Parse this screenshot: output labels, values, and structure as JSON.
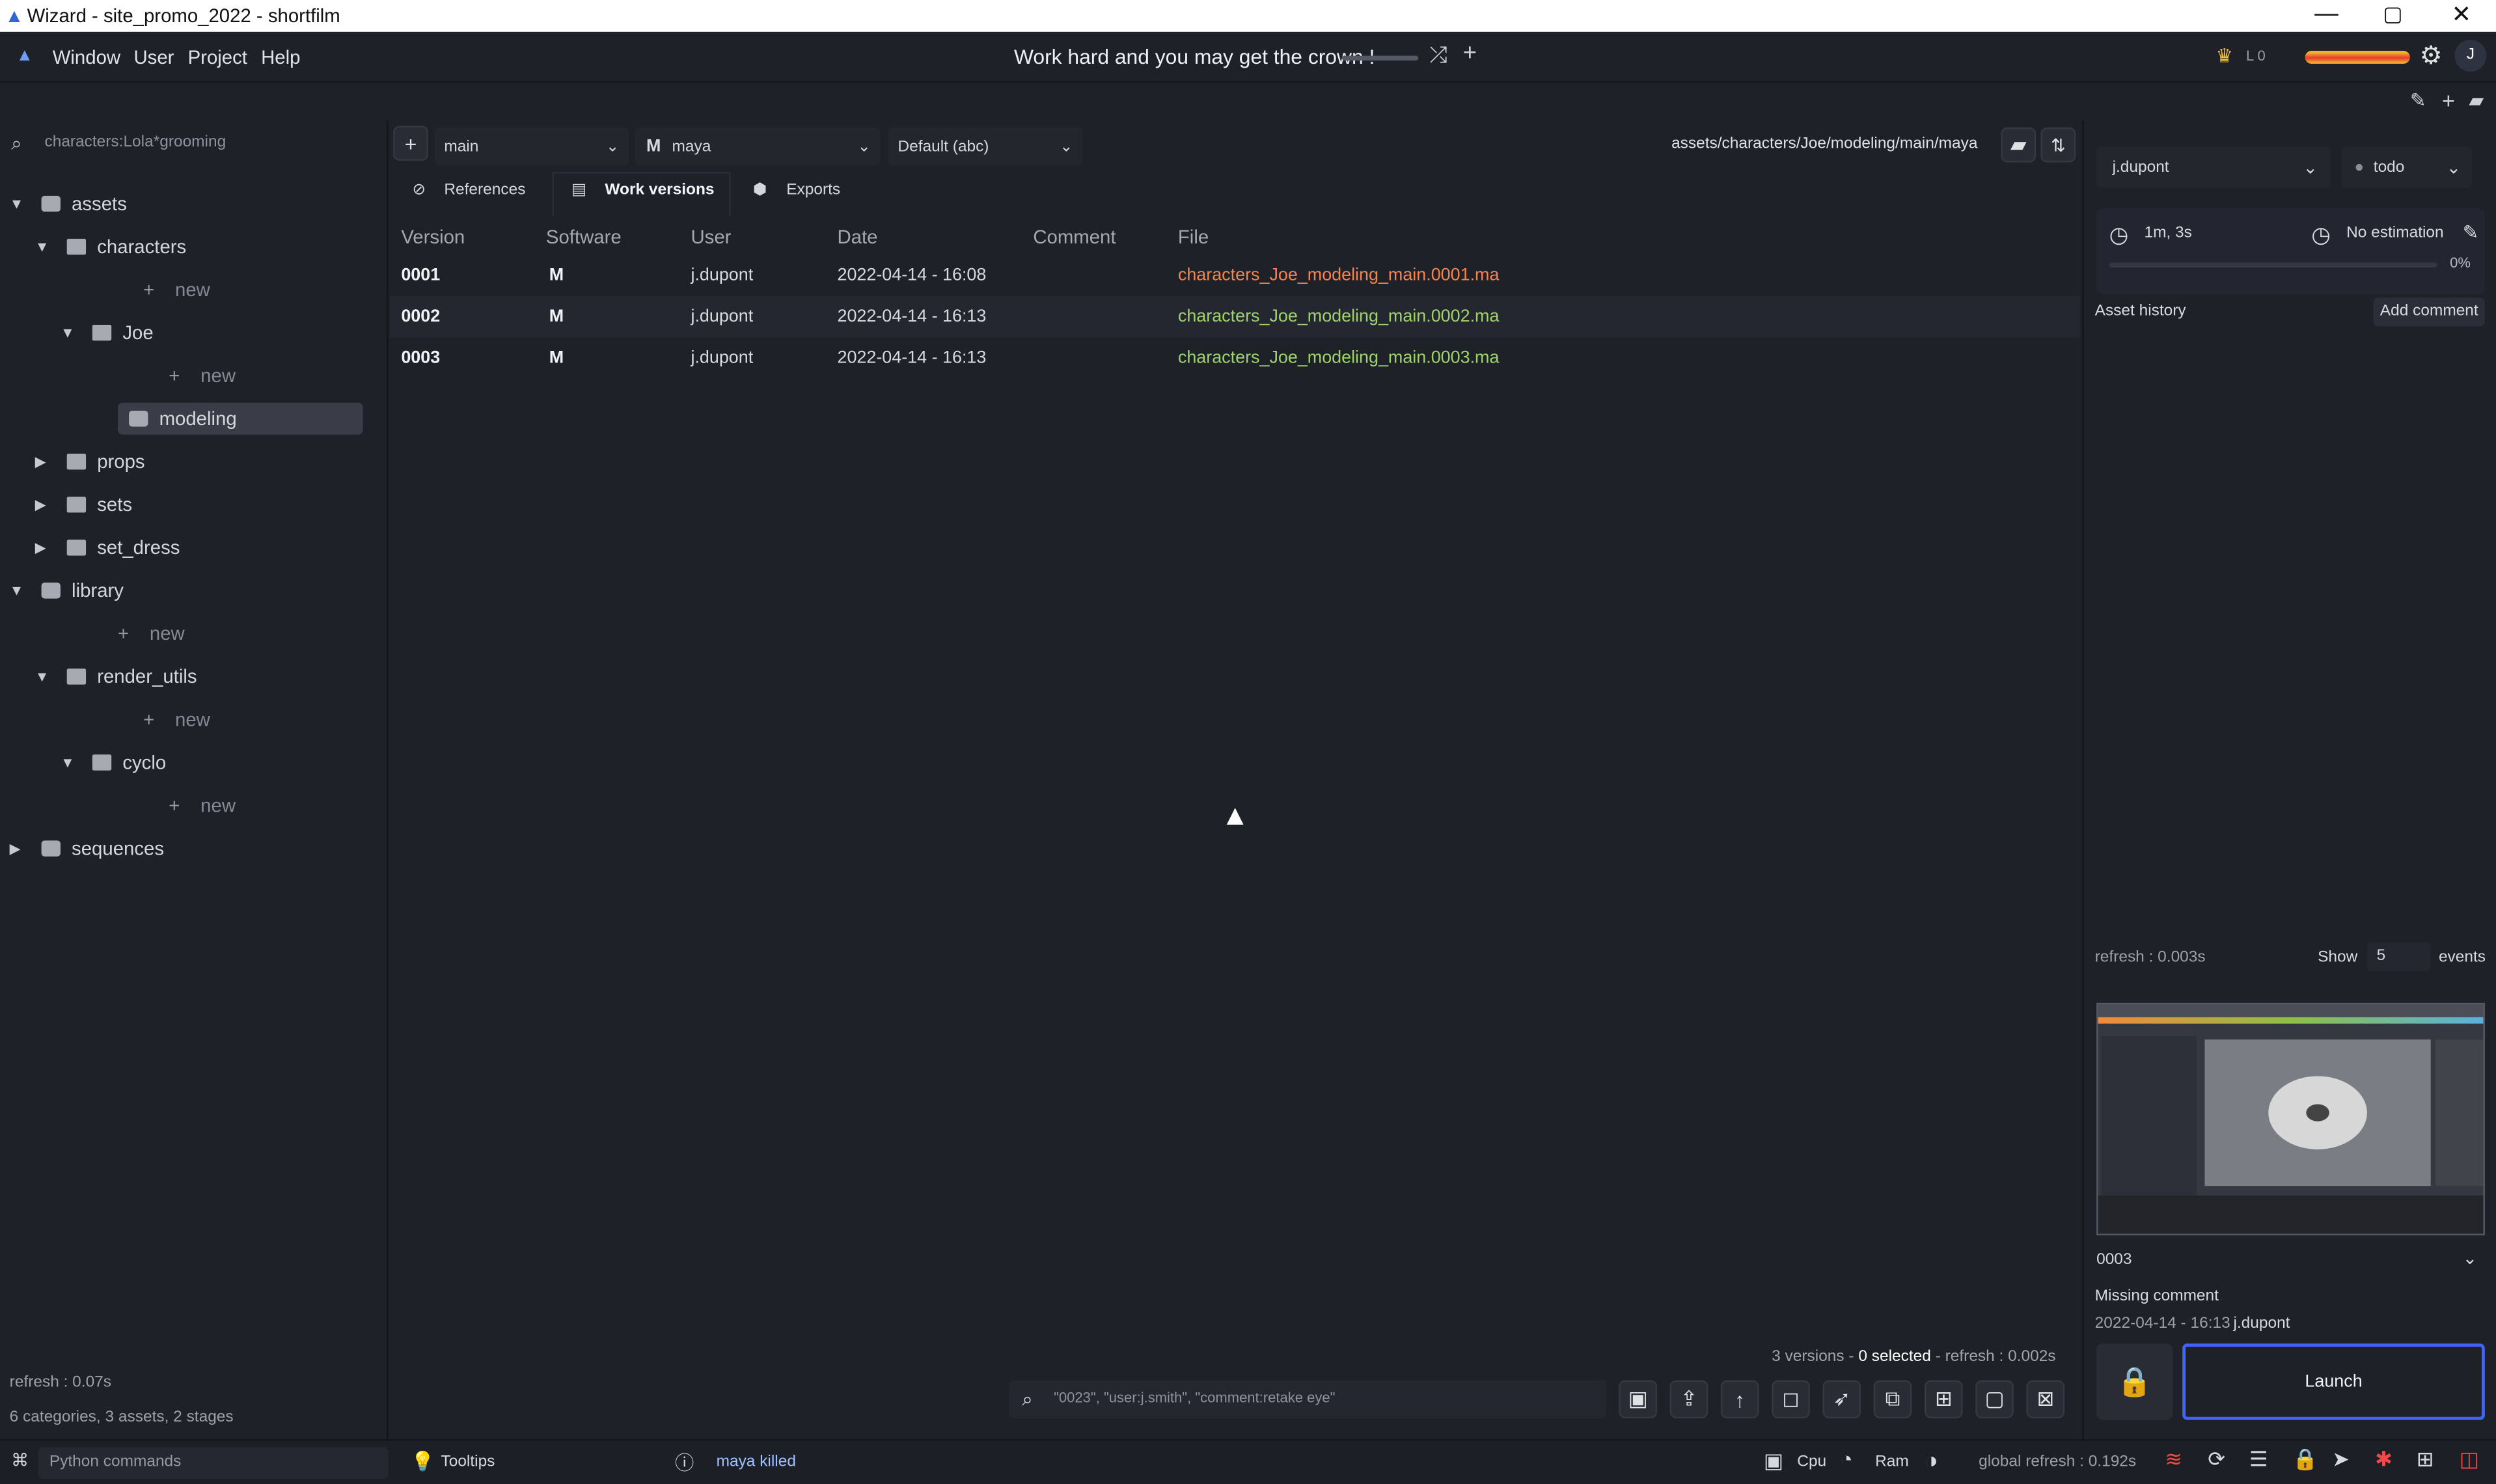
{
  "window": {
    "title": "Wizard - site_promo_2022 - shortfilm",
    "app_icon": "wizard-icon",
    "controls": [
      "minimize-icon",
      "restore-icon",
      "close-icon"
    ]
  },
  "menu": {
    "items": [
      "Window",
      "User",
      "Project",
      "Help"
    ],
    "motto": "Work hard and you may get the crown !",
    "level": "L 0",
    "avatar": "J"
  },
  "sidebar": {
    "search_placeholder": "characters:Lola*grooming",
    "tree": [
      {
        "label": "assets",
        "indent": 0,
        "type": "assets",
        "expanded": true
      },
      {
        "label": "characters",
        "indent": 1,
        "type": "folder",
        "expanded": true
      },
      {
        "label": "new",
        "indent": 2,
        "type": "new"
      },
      {
        "label": "Joe",
        "indent": 2,
        "type": "folder",
        "expanded": true
      },
      {
        "label": "new",
        "indent": 3,
        "type": "new"
      },
      {
        "label": "modeling",
        "indent": 3,
        "type": "stage",
        "selected": true
      },
      {
        "label": "props",
        "indent": 1,
        "type": "folder",
        "expanded": false
      },
      {
        "label": "sets",
        "indent": 1,
        "type": "folder",
        "expanded": false
      },
      {
        "label": "set_dress",
        "indent": 1,
        "type": "folder",
        "expanded": false
      },
      {
        "label": "library",
        "indent": 0,
        "type": "library",
        "expanded": true
      },
      {
        "label": "new",
        "indent": 1,
        "type": "new"
      },
      {
        "label": "render_utils",
        "indent": 1,
        "type": "folder",
        "expanded": true
      },
      {
        "label": "new",
        "indent": 2,
        "type": "new"
      },
      {
        "label": "cyclo",
        "indent": 2,
        "type": "folder",
        "expanded": true
      },
      {
        "label": "new",
        "indent": 3,
        "type": "new"
      },
      {
        "label": "sequences",
        "indent": 0,
        "type": "sequences",
        "expanded": false
      }
    ],
    "refresh": "refresh : 0.07s",
    "summary": "6 categories, 3 assets, 2 stages"
  },
  "center": {
    "variant": "main",
    "software": "maya",
    "export": "Default (abc)",
    "software_icon": "M",
    "path": "assets/characters/Joe/modeling/main/maya",
    "tabs": [
      "References",
      "Work versions",
      "Exports"
    ],
    "active_tab": "Work versions",
    "columns": [
      "Version",
      "Software",
      "User",
      "Date",
      "Comment",
      "File"
    ],
    "rows": [
      {
        "version": "0001",
        "software": "M",
        "user": "j.dupont",
        "date": "2022-04-14 - 16:08",
        "comment": "",
        "file": "characters_Joe_modeling_main.0001.ma",
        "file_color": "orange"
      },
      {
        "version": "0002",
        "software": "M",
        "user": "j.dupont",
        "date": "2022-04-14 - 16:13",
        "comment": "",
        "file": "characters_Joe_modeling_main.0002.ma",
        "file_color": "green"
      },
      {
        "version": "0003",
        "software": "M",
        "user": "j.dupont",
        "date": "2022-04-14 - 16:13",
        "comment": "",
        "file": "characters_Joe_modeling_main.0003.ma",
        "file_color": "green"
      }
    ],
    "footer_versions": "3 versions - ",
    "footer_selected": "0 selected",
    "footer_refresh": " - refresh : 0.002s",
    "search_placeholder": "\"0023\", \"user:j.smith\", \"comment:retake eye\""
  },
  "right": {
    "user": "j.dupont",
    "state": "todo",
    "time": "1m, 3s",
    "estimation": "No estimation",
    "progress": "0%",
    "asset_history": "Asset history",
    "add_comment": "Add comment",
    "refresh": "refresh : 0.003s",
    "show": "Show",
    "events_count": "5",
    "events": "events",
    "version": "0003",
    "missing_comment": "Missing comment",
    "date": "2022-04-14 - 16:13",
    "user2": "j.dupont",
    "launch": "Launch"
  },
  "status": {
    "python": "Python commands",
    "tooltips": "Tooltips",
    "message": "maya killed",
    "cpu": "Cpu",
    "ram": "Ram",
    "global_refresh": "global refresh : 0.192s"
  },
  "colors": {
    "background": "#1f2129",
    "accent": "#3f63ff",
    "orange": "#f2854e",
    "green": "#9ed36b",
    "xp": "#f6d12b"
  }
}
